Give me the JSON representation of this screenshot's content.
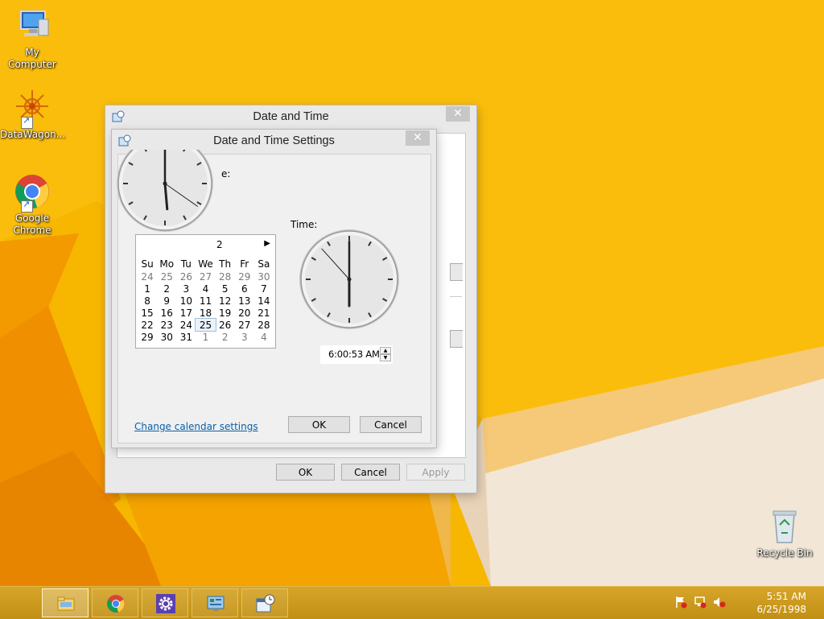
{
  "desktop": {
    "icons": [
      {
        "label": "My Computer"
      },
      {
        "label": "DataWagon..."
      },
      {
        "label": "Google Chrome"
      },
      {
        "label": "Recycle Bin"
      }
    ]
  },
  "outer_dialog": {
    "title": "Date and Time",
    "close_glyph": "✕",
    "ok_label": "OK",
    "cancel_label": "Cancel",
    "apply_label": "Apply",
    "partial_text": "e:"
  },
  "inner_dialog": {
    "title": "Date and Time Settings",
    "close_glyph": "✕",
    "time_label": "Time:",
    "time_value": "6:00:53 AM",
    "change_calendar_link": "Change calendar settings",
    "ok_label": "OK",
    "cancel_label": "Cancel",
    "calendar": {
      "month_title_partial": "2",
      "next_glyph": "▶",
      "weekdays": [
        "Su",
        "Mo",
        "Tu",
        "We",
        "Th",
        "Fr",
        "Sa"
      ],
      "weeks": [
        [
          "24",
          "25",
          "26",
          "27",
          "28",
          "29",
          "30"
        ],
        [
          "1",
          "2",
          "3",
          "4",
          "5",
          "6",
          "7"
        ],
        [
          "8",
          "9",
          "10",
          "11",
          "12",
          "13",
          "14"
        ],
        [
          "15",
          "16",
          "17",
          "18",
          "19",
          "20",
          "21"
        ],
        [
          "22",
          "23",
          "24",
          "25",
          "26",
          "27",
          "28"
        ],
        [
          "29",
          "30",
          "31",
          "1",
          "2",
          "3",
          "4"
        ]
      ],
      "selected_day": "25"
    }
  },
  "taskbar": {
    "items": [
      "file-explorer",
      "google-chrome",
      "settings",
      "control-panel",
      "date-and-time"
    ],
    "tray_icons": [
      "action-center-flag-icon",
      "network-icon",
      "volume-muted-icon"
    ],
    "clock_time": "5:51 AM",
    "clock_date": "6/25/1998"
  },
  "colors": {
    "desktop_yellow": "#f6b300",
    "taskbar": "#c99a1c",
    "link": "#0b5fa7"
  }
}
